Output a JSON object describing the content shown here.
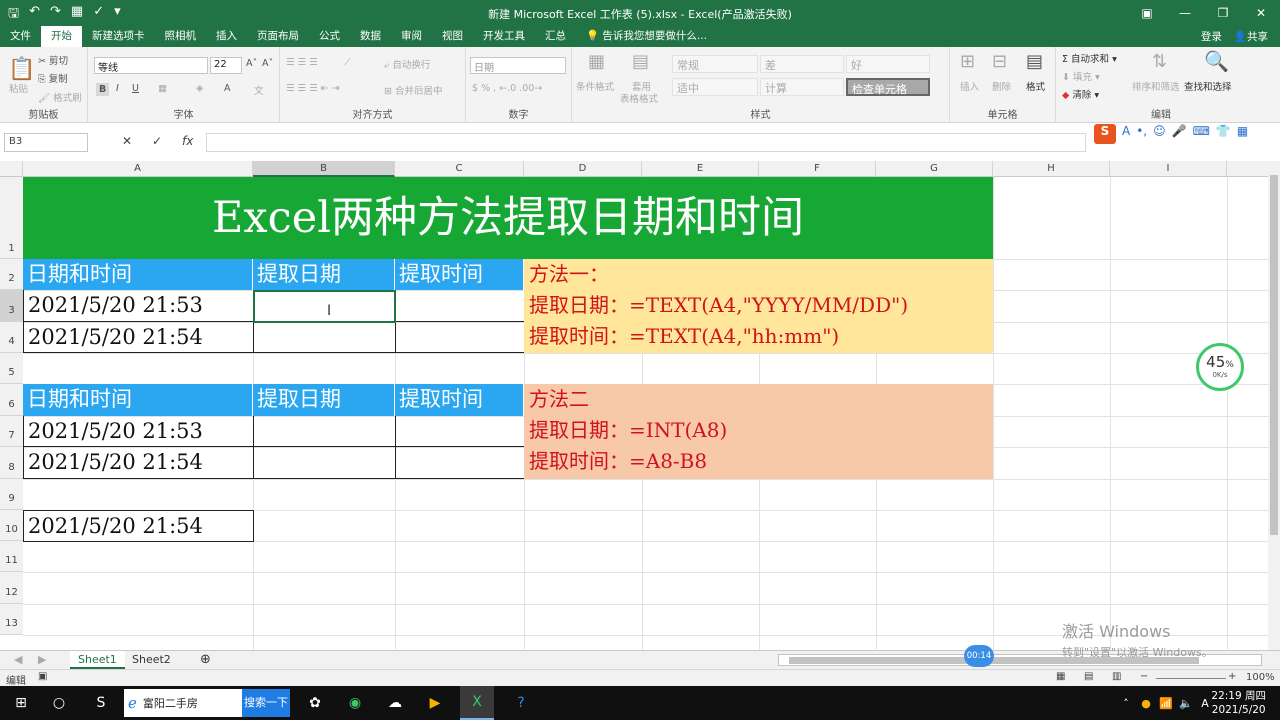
{
  "window": {
    "title": "新建 Microsoft Excel 工作表 (5).xlsx - Excel(产品激活失败)"
  },
  "menu": {
    "tabs": [
      "文件",
      "开始",
      "新建选项卡",
      "照相机",
      "插入",
      "页面布局",
      "公式",
      "数据",
      "审阅",
      "视图",
      "开发工具",
      "汇总"
    ],
    "active_index": 1,
    "tell_me": "告诉我您想要做什么...",
    "login": "登录",
    "share": "共享"
  },
  "ribbon": {
    "clipboard": {
      "paste": "粘贴",
      "cut": "剪切",
      "copy": "复制",
      "format_painter": "格式刷",
      "label": "剪贴板"
    },
    "font": {
      "name": "等线",
      "size": "22",
      "label": "字体"
    },
    "alignment": {
      "wrap": "自动换行",
      "merge": "合并后居中",
      "label": "对齐方式"
    },
    "number": {
      "format": "日期",
      "label": "数字"
    },
    "styles": {
      "conditional": "条件格式",
      "table": "套用",
      "table2": "表格格式",
      "normal": "常规",
      "bad": "差",
      "good": "好",
      "neutral": "适中",
      "calc": "计算",
      "check": "检查单元格",
      "label": "样式"
    },
    "cells": {
      "insert": "插入",
      "delete": "删除",
      "format": "格式",
      "label": "单元格"
    },
    "editing": {
      "autosum": "自动求和",
      "fill": "填充",
      "clear": "清除",
      "sort": "排序和筛选",
      "find": "查找和选择",
      "label": "编辑"
    }
  },
  "formula_bar": {
    "name_box": "B3",
    "content": ""
  },
  "columns": [
    "A",
    "B",
    "C",
    "D",
    "E",
    "F",
    "G",
    "H",
    "I"
  ],
  "rows": [
    "1",
    "2",
    "3",
    "4",
    "5",
    "6",
    "7",
    "8",
    "9",
    "10",
    "11",
    "12",
    "13"
  ],
  "sheet": {
    "title": "Excel两种方法提取日期和时间",
    "headers": [
      "日期和时间",
      "提取日期",
      "提取时间"
    ],
    "table1": [
      "2021/5/20 21:53",
      "2021/5/20 21:54"
    ],
    "table2": [
      "2021/5/20 21:53",
      "2021/5/20 21:54"
    ],
    "a10": "2021/5/20 21:54",
    "method1": [
      "方法一：",
      "提取日期：=TEXT(A4,\"YYYY/MM/DD\")",
      "提取时间：=TEXT(A4,\"hh:mm\")"
    ],
    "method2": [
      "方法二",
      "提取日期：=INT(A8)",
      "提取时间：=A8-B8"
    ]
  },
  "sheet_tabs": [
    "Sheet1",
    "Sheet2"
  ],
  "status": {
    "mode": "编辑",
    "zoom": "100%"
  },
  "overlay": {
    "speed_pct": "45",
    "speed_unit": "%",
    "speed_rate": "0K/s",
    "video_time": "00:14",
    "watermark": "激活 Windows",
    "watermark_sub": "转到\"设置\"以激活 Windows。"
  },
  "taskbar": {
    "app": "富阳二手房",
    "search_btn": "搜索一下",
    "time": "22:19 周四",
    "date": "2021/5/20"
  }
}
